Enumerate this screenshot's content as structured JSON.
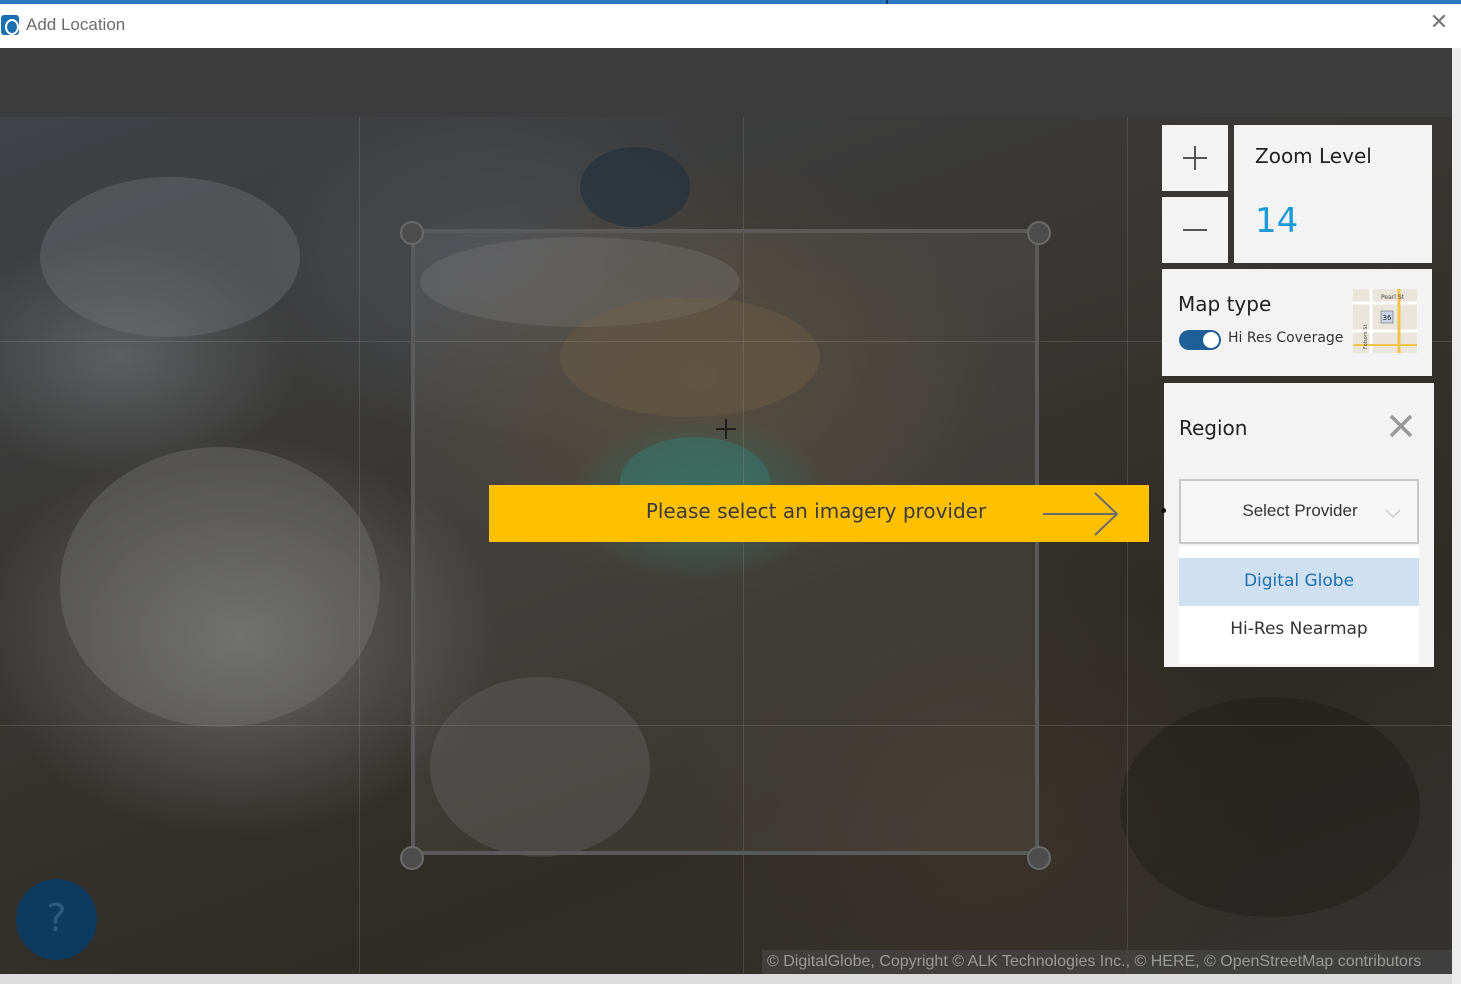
{
  "window": {
    "title": "Add Location",
    "close_icon": "close-icon"
  },
  "banner": {
    "text": "Please select an imagery provider",
    "color": "#ffc000"
  },
  "zoom": {
    "title": "Zoom Level",
    "value": "14",
    "value_color": "#1a9ad6"
  },
  "map_type": {
    "title": "Map type",
    "toggle_label": "Hi Res Coverage",
    "toggle_on": true
  },
  "region": {
    "title": "Region",
    "select_placeholder": "Select Provider",
    "options": [
      {
        "label": "Digital Globe",
        "highlighted": true
      },
      {
        "label": "Hi-Res Nearmap",
        "highlighted": false
      }
    ]
  },
  "help": {
    "label": "?"
  },
  "attribution": "© DigitalGlobe, Copyright © ALK Technologies Inc., © HERE, © OpenStreetMap contributors",
  "thumbnail": {
    "street_1": "Pearl St",
    "street_2": "Folsom St",
    "route": "36"
  }
}
